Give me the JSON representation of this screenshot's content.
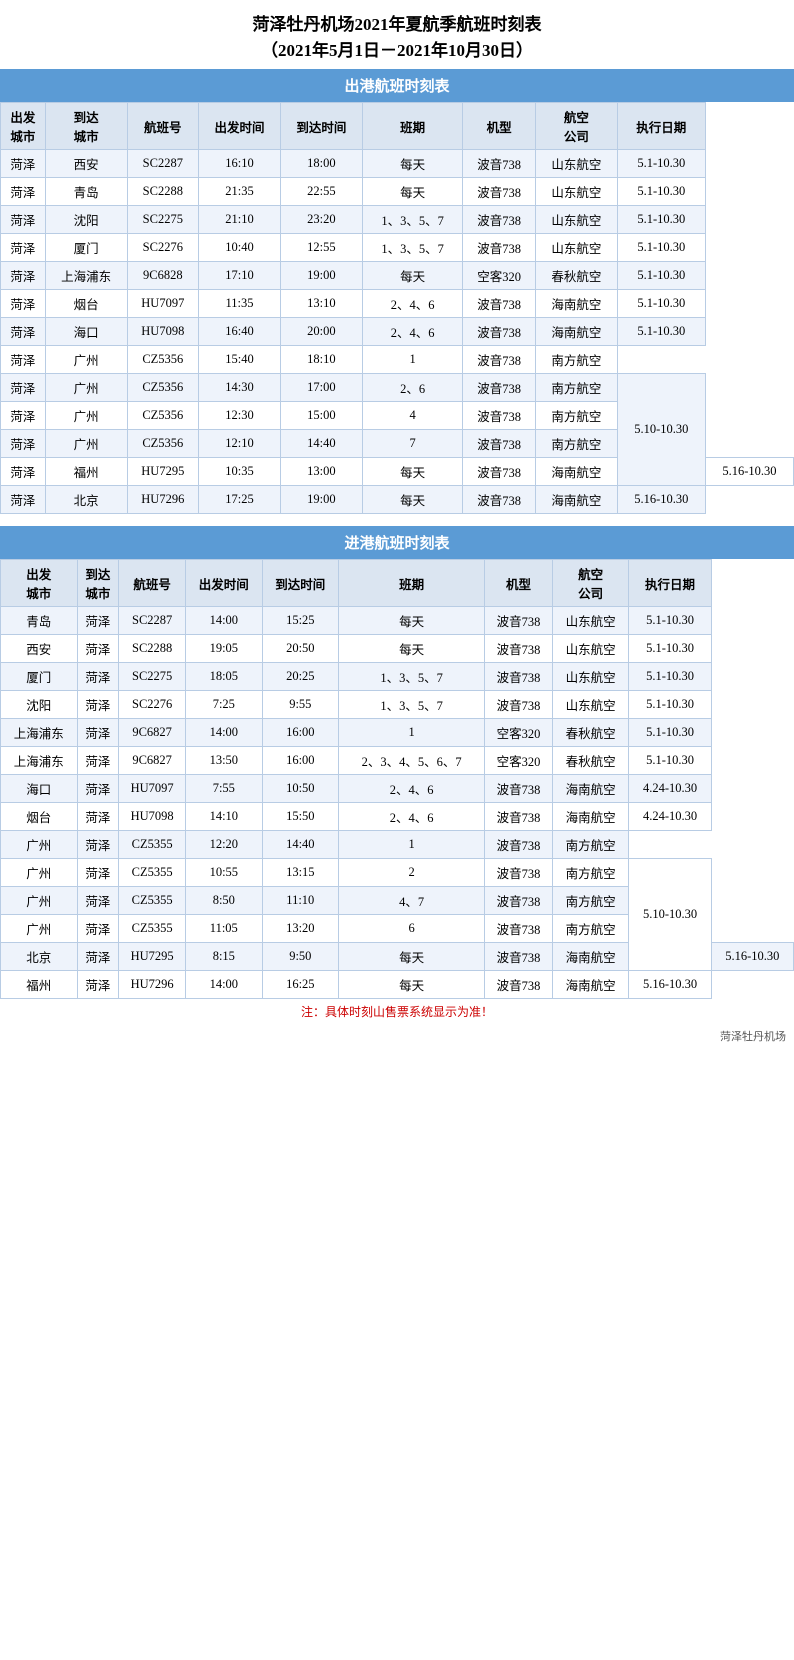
{
  "title": {
    "line1": "菏泽牡丹机场2021年夏航季航班时刻表",
    "line2": "（2021年5月1日－2021年10月30日）"
  },
  "departure": {
    "section_title": "出港航班时刻表",
    "columns": [
      "出发城市",
      "到达城市",
      "航班号",
      "出发时间",
      "到达时间",
      "班期",
      "机型",
      "航空公司",
      "执行日期"
    ],
    "rows": [
      [
        "菏泽",
        "西安",
        "SC2287",
        "16:10",
        "18:00",
        "每天",
        "波音738",
        "山东航空",
        "5.1-10.30"
      ],
      [
        "菏泽",
        "青岛",
        "SC2288",
        "21:35",
        "22:55",
        "每天",
        "波音738",
        "山东航空",
        "5.1-10.30"
      ],
      [
        "菏泽",
        "沈阳",
        "SC2275",
        "21:10",
        "23:20",
        "1、3、5、7",
        "波音738",
        "山东航空",
        "5.1-10.30"
      ],
      [
        "菏泽",
        "厦门",
        "SC2276",
        "10:40",
        "12:55",
        "1、3、5、7",
        "波音738",
        "山东航空",
        "5.1-10.30"
      ],
      [
        "菏泽",
        "上海浦东",
        "9C6828",
        "17:10",
        "19:00",
        "每天",
        "空客320",
        "春秋航空",
        "5.1-10.30"
      ],
      [
        "菏泽",
        "烟台",
        "HU7097",
        "11:35",
        "13:10",
        "2、4、6",
        "波音738",
        "海南航空",
        "5.1-10.30"
      ],
      [
        "菏泽",
        "海口",
        "HU7098",
        "16:40",
        "20:00",
        "2、4、6",
        "波音738",
        "海南航空",
        "5.1-10.30"
      ],
      [
        "菏泽",
        "广州",
        "CZ5356",
        "15:40",
        "18:10",
        "1",
        "波音738",
        "南方航空",
        ""
      ],
      [
        "菏泽",
        "广州",
        "CZ5356",
        "14:30",
        "17:00",
        "2、6",
        "波音738",
        "南方航空",
        "5.10-10.30"
      ],
      [
        "菏泽",
        "广州",
        "CZ5356",
        "12:30",
        "15:00",
        "4",
        "波音738",
        "南方航空",
        ""
      ],
      [
        "菏泽",
        "广州",
        "CZ5356",
        "12:10",
        "14:40",
        "7",
        "波音738",
        "南方航空",
        ""
      ],
      [
        "菏泽",
        "福州",
        "HU7295",
        "10:35",
        "13:00",
        "每天",
        "波音738",
        "海南航空",
        "5.16-10.30"
      ],
      [
        "菏泽",
        "北京",
        "HU7296",
        "17:25",
        "19:00",
        "每天",
        "波音738",
        "海南航空",
        "5.16-10.30"
      ]
    ]
  },
  "arrival": {
    "section_title": "进港航班时刻表",
    "columns": [
      "出发城市",
      "到达城市",
      "航班号",
      "出发时间",
      "到达时间",
      "班期",
      "机型",
      "航空公司",
      "执行日期"
    ],
    "rows": [
      [
        "青岛",
        "菏泽",
        "SC2287",
        "14:00",
        "15:25",
        "每天",
        "波音738",
        "山东航空",
        "5.1-10.30"
      ],
      [
        "西安",
        "菏泽",
        "SC2288",
        "19:05",
        "20:50",
        "每天",
        "波音738",
        "山东航空",
        "5.1-10.30"
      ],
      [
        "厦门",
        "菏泽",
        "SC2275",
        "18:05",
        "20:25",
        "1、3、5、7",
        "波音738",
        "山东航空",
        "5.1-10.30"
      ],
      [
        "沈阳",
        "菏泽",
        "SC2276",
        "7:25",
        "9:55",
        "1、3、5、7",
        "波音738",
        "山东航空",
        "5.1-10.30"
      ],
      [
        "上海浦东",
        "菏泽",
        "9C6827",
        "14:00",
        "16:00",
        "1",
        "空客320",
        "春秋航空",
        "5.1-10.30"
      ],
      [
        "上海浦东",
        "菏泽",
        "9C6827",
        "13:50",
        "16:00",
        "2、3、4、5、6、7",
        "空客320",
        "春秋航空",
        "5.1-10.30"
      ],
      [
        "海口",
        "菏泽",
        "HU7097",
        "7:55",
        "10:50",
        "2、4、6",
        "波音738",
        "海南航空",
        "4.24-10.30"
      ],
      [
        "烟台",
        "菏泽",
        "HU7098",
        "14:10",
        "15:50",
        "2、4、6",
        "波音738",
        "海南航空",
        "4.24-10.30"
      ],
      [
        "广州",
        "菏泽",
        "CZ5355",
        "12:20",
        "14:40",
        "1",
        "波音738",
        "南方航空",
        ""
      ],
      [
        "广州",
        "菏泽",
        "CZ5355",
        "10:55",
        "13:15",
        "2",
        "波音738",
        "南方航空",
        "5.10-10.30"
      ],
      [
        "广州",
        "菏泽",
        "CZ5355",
        "8:50",
        "11:10",
        "4、7",
        "波音738",
        "南方航空",
        ""
      ],
      [
        "广州",
        "菏泽",
        "CZ5355",
        "11:05",
        "13:20",
        "6",
        "波音738",
        "南方航空",
        ""
      ],
      [
        "北京",
        "菏泽",
        "HU7295",
        "8:15",
        "9:50",
        "每天",
        "波音738",
        "海南航空",
        "5.16-10.30"
      ],
      [
        "福州",
        "菏泽",
        "HU7296",
        "14:00",
        "16:25",
        "每天",
        "波音738",
        "海南航空",
        "5.16-10.30"
      ]
    ]
  },
  "footer": {
    "note": "注：具体时刻山售票系统显示为准！",
    "watermark": "菏泽牡丹机场"
  }
}
